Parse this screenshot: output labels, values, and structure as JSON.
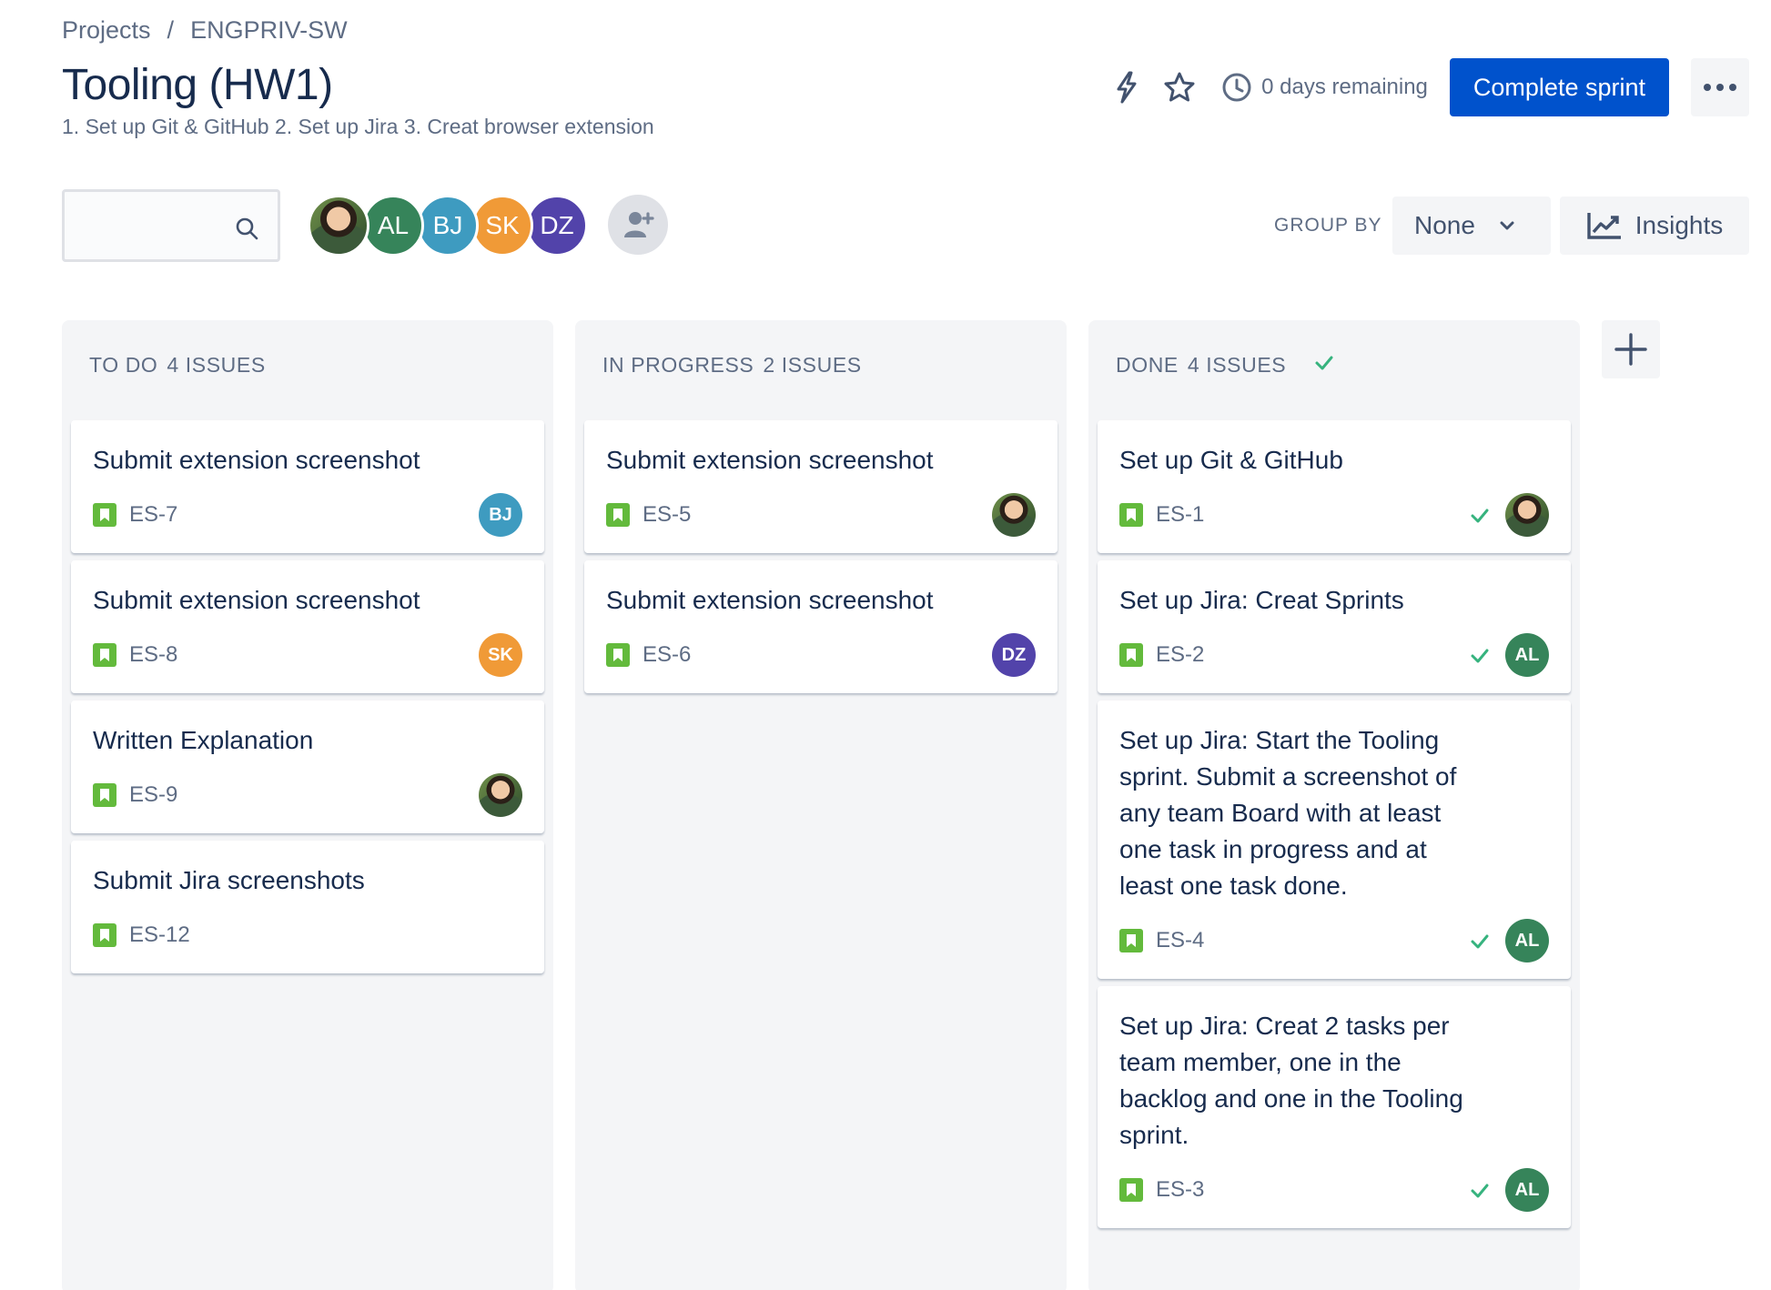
{
  "breadcrumb": {
    "projects": "Projects",
    "separator": "/",
    "project": "ENGPRIV-SW"
  },
  "sprint": {
    "title": "Tooling (HW1)",
    "goal": "1. Set up Git & GitHub 2. Set up Jira 3. Creat browser extension",
    "days_remaining": "0 days remaining",
    "complete_label": "Complete sprint"
  },
  "toolbar": {
    "search_placeholder": "",
    "group_by_label": "GROUP BY",
    "group_by_value": "None",
    "insights_label": "Insights"
  },
  "avatars": [
    {
      "initials": "",
      "color": "#6f8f4a",
      "photo": true
    },
    {
      "initials": "AL",
      "color": "#36845a",
      "photo": false
    },
    {
      "initials": "BJ",
      "color": "#3e9bc0",
      "photo": false
    },
    {
      "initials": "SK",
      "color": "#f09a37",
      "photo": false
    },
    {
      "initials": "DZ",
      "color": "#5243aa",
      "photo": false
    }
  ],
  "colors": {
    "primary": "#0052cc",
    "story": "#63ba3c",
    "done_check": "#36b37e"
  },
  "columns": [
    {
      "name": "TO DO",
      "count_label": "4 ISSUES",
      "done": false,
      "cards": [
        {
          "title": "Submit extension screenshot",
          "key": "ES-7",
          "assignee": "BJ",
          "done": false
        },
        {
          "title": "Submit extension screenshot",
          "key": "ES-8",
          "assignee": "SK",
          "done": false
        },
        {
          "title": "Written Explanation",
          "key": "ES-9",
          "assignee": "photo",
          "done": false
        },
        {
          "title": "Submit Jira screenshots",
          "key": "ES-12",
          "assignee": "",
          "done": false
        }
      ]
    },
    {
      "name": "IN PROGRESS",
      "count_label": "2 ISSUES",
      "done": false,
      "cards": [
        {
          "title": "Submit extension screenshot",
          "key": "ES-5",
          "assignee": "photo",
          "done": false
        },
        {
          "title": "Submit extension screenshot",
          "key": "ES-6",
          "assignee": "DZ",
          "done": false
        }
      ]
    },
    {
      "name": "DONE",
      "count_label": "4 ISSUES",
      "done": true,
      "cards": [
        {
          "title": "Set up Git & GitHub",
          "key": "ES-1",
          "assignee": "photo",
          "done": true
        },
        {
          "title": "Set up Jira: Creat Sprints",
          "key": "ES-2",
          "assignee": "AL",
          "done": true
        },
        {
          "title": "Set up Jira: Start the Tooling sprint. Submit a screenshot of any team Board with at least one task in progress and at least one task done.",
          "key": "ES-4",
          "assignee": "AL",
          "done": true
        },
        {
          "title": "Set up Jira: Creat 2 tasks per team member, one in the backlog and one in the Tooling sprint.",
          "key": "ES-3",
          "assignee": "AL",
          "done": true
        }
      ]
    }
  ]
}
